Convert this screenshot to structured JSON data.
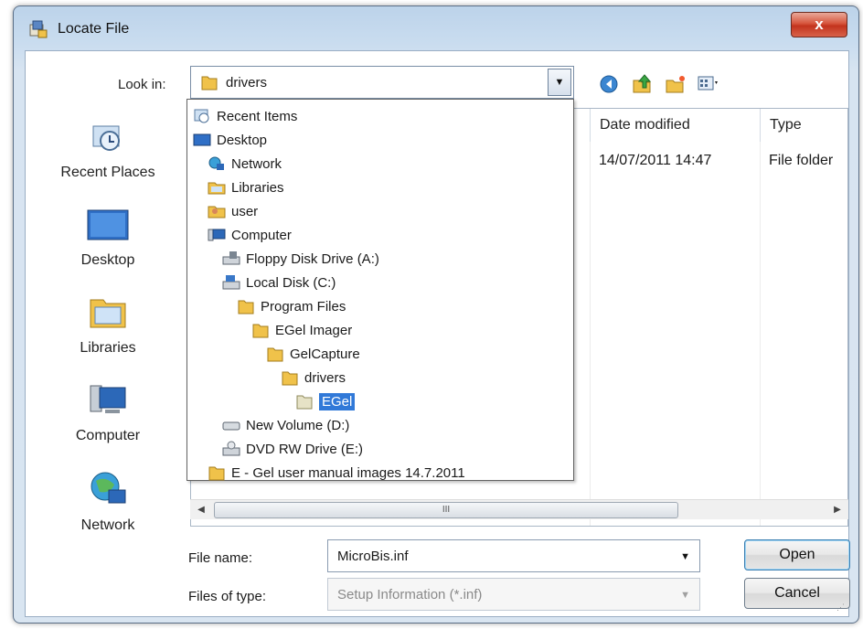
{
  "window": {
    "title": "Locate File",
    "close_glyph": "x"
  },
  "lookin": {
    "label": "Look in:",
    "value": "drivers",
    "drop_glyph": "▼"
  },
  "places": [
    {
      "label": "Recent Places",
      "icon": "recent-places-icon"
    },
    {
      "label": "Desktop",
      "icon": "desktop-icon"
    },
    {
      "label": "Libraries",
      "icon": "libraries-icon"
    },
    {
      "label": "Computer",
      "icon": "computer-icon"
    },
    {
      "label": "Network",
      "icon": "network-icon"
    }
  ],
  "filelist": {
    "columns": {
      "date": "Date modified",
      "type": "Type"
    },
    "row": {
      "date": "14/07/2011 14:47",
      "type": "File folder"
    }
  },
  "dropdown": {
    "items": [
      {
        "label": "Recent Items",
        "icon": "recent-items-icon"
      },
      {
        "label": "Desktop",
        "icon": "desktop-icon"
      },
      {
        "label": "Network",
        "icon": "network-icon"
      },
      {
        "label": "Libraries",
        "icon": "libraries-icon"
      },
      {
        "label": "user",
        "icon": "user-icon"
      },
      {
        "label": "Computer",
        "icon": "computer-icon"
      },
      {
        "label": "Floppy Disk Drive (A:)",
        "icon": "floppy-drive-icon"
      },
      {
        "label": "Local Disk (C:)",
        "icon": "local-disk-icon"
      },
      {
        "label": "Program Files",
        "icon": "folder-icon"
      },
      {
        "label": "EGel Imager",
        "icon": "folder-icon"
      },
      {
        "label": "GelCapture",
        "icon": "folder-icon"
      },
      {
        "label": "drivers",
        "icon": "folder-icon"
      },
      {
        "label": "EGel",
        "icon": "folder-icon",
        "selected": true
      },
      {
        "label": "New Volume (D:)",
        "icon": "drive-icon"
      },
      {
        "label": "DVD RW Drive (E:)",
        "icon": "dvd-drive-icon"
      },
      {
        "label": "E - Gel user manual images 14.7.2011",
        "icon": "folder-icon"
      }
    ]
  },
  "scrollbar": {
    "left": "◀",
    "right": "▶",
    "grip": "III"
  },
  "form": {
    "file_name_label": "File name:",
    "file_name_value": "MicroBis.inf",
    "file_type_label": "Files of type:",
    "file_type_value": "Setup Information (*.inf)",
    "drop_glyph": "▼"
  },
  "buttons": {
    "open": "Open",
    "cancel": "Cancel"
  },
  "colors": {
    "selection": "#3179d8",
    "folder": "#f0c24a"
  }
}
